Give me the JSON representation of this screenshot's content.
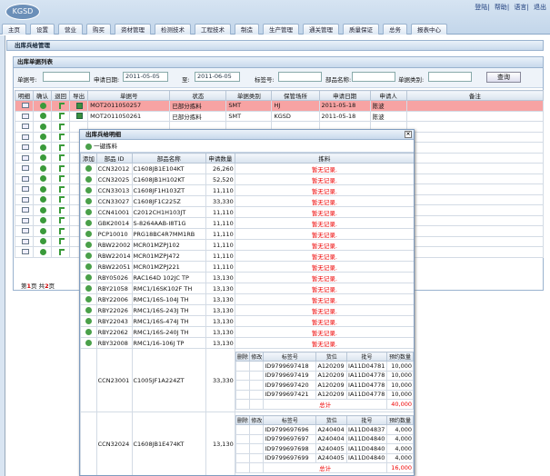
{
  "app": {
    "logo": "KGSD",
    "links": [
      "登陆",
      "帮助",
      "语言",
      "退出"
    ]
  },
  "nav": [
    "主页",
    "设置",
    "营业",
    "购买",
    "资材管理",
    "检测技术",
    "工程技术",
    "制造",
    "生产管理",
    "通关管理",
    "质量保证",
    "总务",
    "报表中心"
  ],
  "page_title": "出库兵给管理",
  "list": {
    "title": "出库单据列表",
    "search": {
      "doc_no_label": "单据号:",
      "date_label": "申请日期:",
      "date_from": "2011-05-05",
      "to_label": "至:",
      "date_to": "2011-06-05",
      "tag_label": "标签号:",
      "part_label": "部品名称:",
      "type_label": "单据类别:",
      "query_button": "查询"
    },
    "columns": [
      "明细",
      "确认",
      "退回",
      "导出",
      "单据号",
      "状态",
      "单据类别",
      "保管场所",
      "申请日期",
      "申请人",
      "备注"
    ],
    "rows": [
      {
        "doc": "MOT2011050257",
        "status": "已部分拣料",
        "type": "SMT",
        "place": "HJ",
        "date": "2011-05-18",
        "user": "陈波"
      },
      {
        "doc": "MOT2011050261",
        "status": "已部分拣料",
        "type": "SMT",
        "place": "KGSD",
        "date": "2011-05-18",
        "user": "陈波"
      }
    ],
    "pager": {
      "text1": "第",
      "page": "1",
      "text2": "页 共",
      "total": "2",
      "text3": "页"
    }
  },
  "detail": {
    "title": "出库兵给明细",
    "tool": "一键拣料",
    "columns": [
      "添加",
      "部品 ID",
      "部品名称",
      "申请数量",
      "拣料"
    ],
    "no_record": "暂无记录.",
    "rows": [
      {
        "id": "CCN32012",
        "name": "C1608JB1E104KT",
        "qty": "26,260"
      },
      {
        "id": "CCN32025",
        "name": "C1608JB1H102KT",
        "qty": "52,520"
      },
      {
        "id": "CCN33013",
        "name": "C1608JF1H103ZT",
        "qty": "11,110"
      },
      {
        "id": "CCN33027",
        "name": "C1608JF1C225Z",
        "qty": "33,330"
      },
      {
        "id": "CCN41001",
        "name": "C2012CH1H103JT",
        "qty": "11,110"
      },
      {
        "id": "GBK20014",
        "name": "S-8264AAB-I8T1G",
        "qty": "11,110"
      },
      {
        "id": "PCP10010",
        "name": "PRG18BC4R7MM1RB",
        "qty": "11,110"
      },
      {
        "id": "RBW22002",
        "name": "MCR01MZPJ102",
        "qty": "11,110"
      },
      {
        "id": "RBW22014",
        "name": "MCR01MZPJ472",
        "qty": "11,110"
      },
      {
        "id": "RBW22051",
        "name": "MCR01MZPJ221",
        "qty": "11,110"
      },
      {
        "id": "RBY05026",
        "name": "RAC164D 102JC TP",
        "qty": "13,130"
      },
      {
        "id": "RBY21058",
        "name": "RMC1/16SK102F TH",
        "qty": "13,130"
      },
      {
        "id": "RBY22006",
        "name": "RMC1/16S-104J TH",
        "qty": "13,130"
      },
      {
        "id": "RBY22026",
        "name": "RMC1/16S-243J TH",
        "qty": "13,130"
      },
      {
        "id": "RBY22043",
        "name": "RMC1/16S-474J TH",
        "qty": "13,130"
      },
      {
        "id": "RBY22062",
        "name": "RMC1/16S-240J TH",
        "qty": "13,130"
      },
      {
        "id": "RBY32008",
        "name": "RMC1/16-106J TP",
        "qty": "13,130"
      }
    ],
    "sub_columns": [
      "删除",
      "修改",
      "标签号",
      "货位",
      "批号",
      "预约数量"
    ],
    "total_label": "总计",
    "expanded": [
      {
        "id": "CCN23001",
        "name": "C1005JF1A224ZT",
        "qty": "33,330",
        "total": "40,000",
        "items": [
          {
            "tag": "ID9799697418",
            "loc": "A120209",
            "lot": "IA11D04781",
            "qty": "10,000"
          },
          {
            "tag": "ID9799697419",
            "loc": "A120209",
            "lot": "IA11D04778",
            "qty": "10,000"
          },
          {
            "tag": "ID9799697420",
            "loc": "A120209",
            "lot": "IA11D04778",
            "qty": "10,000"
          },
          {
            "tag": "ID9799697421",
            "loc": "A120209",
            "lot": "IA11D04778",
            "qty": "10,000"
          }
        ]
      },
      {
        "id": "CCN32024",
        "name": "C1608JB1E474KT",
        "qty": "13,130",
        "total": "16,000",
        "items": [
          {
            "tag": "ID9799697696",
            "loc": "A240404",
            "lot": "IA11D04837",
            "qty": "4,000"
          },
          {
            "tag": "ID9799697697",
            "loc": "A240404",
            "lot": "IA11D04840",
            "qty": "4,000"
          },
          {
            "tag": "ID9799697698",
            "loc": "A240405",
            "lot": "IA11D04840",
            "qty": "4,000"
          },
          {
            "tag": "ID9799697699",
            "loc": "A240405",
            "lot": "IA11D04840",
            "qty": "4,000"
          }
        ]
      }
    ]
  },
  "colors": {
    "selected_row": "#f7a3a3",
    "no_record": "#e00000",
    "accent": "#6b8fb8"
  }
}
